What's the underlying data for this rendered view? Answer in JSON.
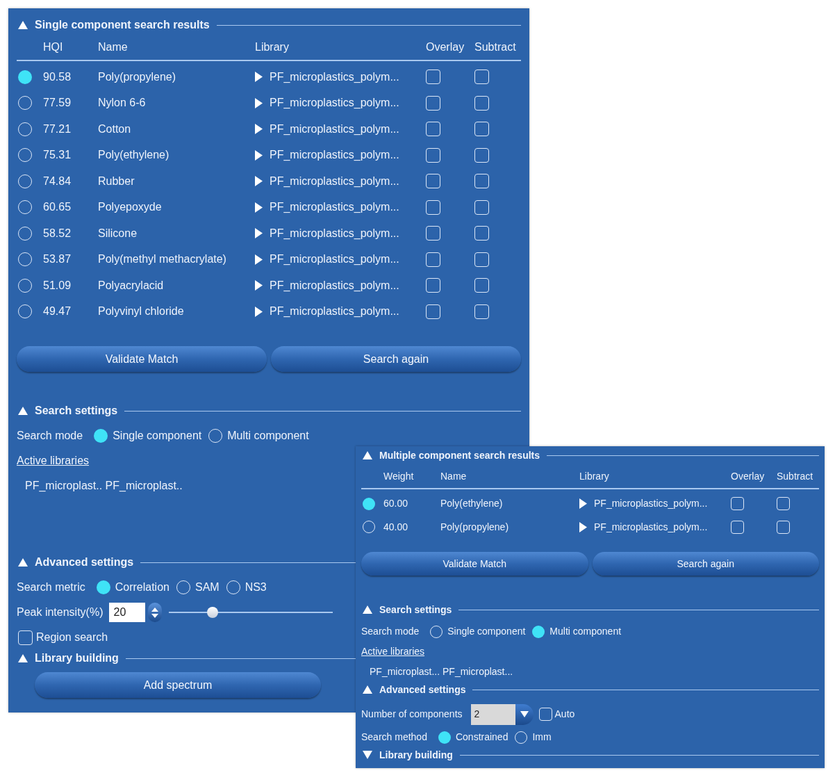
{
  "panels": [
    {
      "sections": [
        {
          "title": "Single component search results",
          "expanded": true,
          "items": [
            {
              "kind": "results_table",
              "columns": [
                "HQI",
                "Name",
                "Library",
                "Overlay",
                "Subtract"
              ],
              "rows": [
                {
                  "selected": true,
                  "score": "90.58",
                  "name": "Poly(propylene)",
                  "library": "PF_microplastics_polym...",
                  "overlay": false,
                  "subtract": false
                },
                {
                  "selected": false,
                  "score": "77.59",
                  "name": "Nylon 6-6",
                  "library": "PF_microplastics_polym...",
                  "overlay": false,
                  "subtract": false
                },
                {
                  "selected": false,
                  "score": "77.21",
                  "name": "Cotton",
                  "library": "PF_microplastics_polym...",
                  "overlay": false,
                  "subtract": false
                },
                {
                  "selected": false,
                  "score": "75.31",
                  "name": "Poly(ethylene)",
                  "library": "PF_microplastics_polym...",
                  "overlay": false,
                  "subtract": false
                },
                {
                  "selected": false,
                  "score": "74.84",
                  "name": "Rubber",
                  "library": "PF_microplastics_polym...",
                  "overlay": false,
                  "subtract": false
                },
                {
                  "selected": false,
                  "score": "60.65",
                  "name": "Polyepoxyde",
                  "library": "PF_microplastics_polym...",
                  "overlay": false,
                  "subtract": false
                },
                {
                  "selected": false,
                  "score": "58.52",
                  "name": "Silicone",
                  "library": "PF_microplastics_polym...",
                  "overlay": false,
                  "subtract": false
                },
                {
                  "selected": false,
                  "score": "53.87",
                  "name": "Poly(methyl methacrylate)",
                  "library": "PF_microplastics_polym...",
                  "overlay": false,
                  "subtract": false
                },
                {
                  "selected": false,
                  "score": "51.09",
                  "name": "Polyacrylacid",
                  "library": "PF_microplastics_polym...",
                  "overlay": false,
                  "subtract": false
                },
                {
                  "selected": false,
                  "score": "49.47",
                  "name": "Polyvinyl chloride",
                  "library": "PF_microplastics_polym...",
                  "overlay": false,
                  "subtract": false
                }
              ]
            },
            {
              "kind": "button_row",
              "buttons": [
                "Validate Match",
                "Search again"
              ]
            }
          ]
        },
        {
          "title": "Search settings",
          "expanded": true,
          "items": [
            {
              "kind": "radio_group",
              "label": "Search mode",
              "options": [
                {
                  "label": "Single component",
                  "selected": true
                },
                {
                  "label": "Multi component",
                  "selected": false
                }
              ]
            },
            {
              "kind": "link",
              "text": "Active libraries"
            },
            {
              "kind": "text",
              "text": "PF_microplast.. PF_microplast.."
            }
          ]
        },
        {
          "title": "Advanced settings",
          "expanded": true,
          "items": [
            {
              "kind": "radio_group",
              "label": "Search metric",
              "options": [
                {
                  "label": "Correlation",
                  "selected": true
                },
                {
                  "label": "SAM",
                  "selected": false
                },
                {
                  "label": "NS3",
                  "selected": false
                }
              ]
            },
            {
              "kind": "spinner",
              "label": "Peak intensity(%)",
              "value": "20",
              "level": 0.25
            },
            {
              "kind": "checkbox",
              "label": "Region search",
              "checked": false
            }
          ]
        },
        {
          "title": "Library building",
          "expanded": true,
          "items": [
            {
              "kind": "button",
              "label": "Add spectrum"
            }
          ]
        }
      ]
    },
    {
      "sections": [
        {
          "title": "Multiple component search results",
          "expanded": true,
          "items": [
            {
              "kind": "results_table",
              "columns": [
                "Weight",
                "Name",
                "Library",
                "Overlay",
                "Subtract"
              ],
              "rows": [
                {
                  "selected": true,
                  "score": "60.00",
                  "name": "Poly(ethylene)",
                  "library": "PF_microplastics_polym...",
                  "overlay": false,
                  "subtract": false
                },
                {
                  "selected": false,
                  "score": "40.00",
                  "name": "Poly(propylene)",
                  "library": "PF_microplastics_polym...",
                  "overlay": false,
                  "subtract": false
                }
              ]
            },
            {
              "kind": "button_row",
              "buttons": [
                "Validate Match",
                "Search again"
              ]
            }
          ]
        },
        {
          "title": "Search settings",
          "expanded": true,
          "items": [
            {
              "kind": "radio_group",
              "label": "Search mode",
              "options": [
                {
                  "label": "Single component",
                  "selected": false
                },
                {
                  "label": "Multi component",
                  "selected": true
                }
              ]
            },
            {
              "kind": "link",
              "text": "Active libraries"
            },
            {
              "kind": "text",
              "text": "PF_microplast... PF_microplast..."
            }
          ]
        },
        {
          "title": "Advanced settings",
          "expanded": true,
          "items": [
            {
              "kind": "combo",
              "label": "Number of components",
              "value": "2",
              "checkbox": {
                "label": "Auto",
                "checked": false
              }
            },
            {
              "kind": "radio_group",
              "label": "Search method",
              "options": [
                {
                  "label": "Constrained",
                  "selected": true
                },
                {
                  "label": "Imm",
                  "selected": false
                }
              ]
            }
          ]
        },
        {
          "title": "Library building",
          "expanded": false
        }
      ]
    }
  ]
}
